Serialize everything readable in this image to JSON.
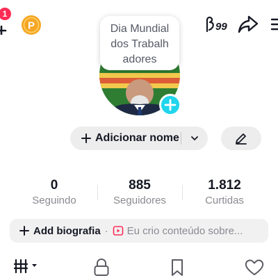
{
  "top_bar": {
    "notification_count": "1",
    "stories_count": "99",
    "icons": [
      "add-friend-icon",
      "points-coin-icon",
      "stories-icon",
      "share-icon",
      "menu-icon"
    ],
    "coin_color": "#f5a623",
    "badge_color": "#fe2c55"
  },
  "profile": {
    "note_lines": [
      "Dia Mundial",
      "dos Trabalh",
      "adores"
    ],
    "avatar_plus_color": "#20d5ec"
  },
  "name_row": {
    "add_name_label": "Adicionar nome",
    "edit_icon": "pencil-icon"
  },
  "stats": [
    {
      "value": "0",
      "label": "Seguindo"
    },
    {
      "value": "885",
      "label": "Seguidores"
    },
    {
      "value": "1.812",
      "label": "Curtidas"
    }
  ],
  "bio": {
    "add_label": "Add biografia",
    "separator": "·",
    "hint": "Eu crio conteúdo sobre..."
  },
  "tabs": [
    {
      "name": "videos",
      "icon": "grid-icon"
    },
    {
      "name": "private",
      "icon": "lock-icon"
    },
    {
      "name": "saved",
      "icon": "bookmark-icon"
    },
    {
      "name": "liked",
      "icon": "heart-outline-icon"
    }
  ]
}
